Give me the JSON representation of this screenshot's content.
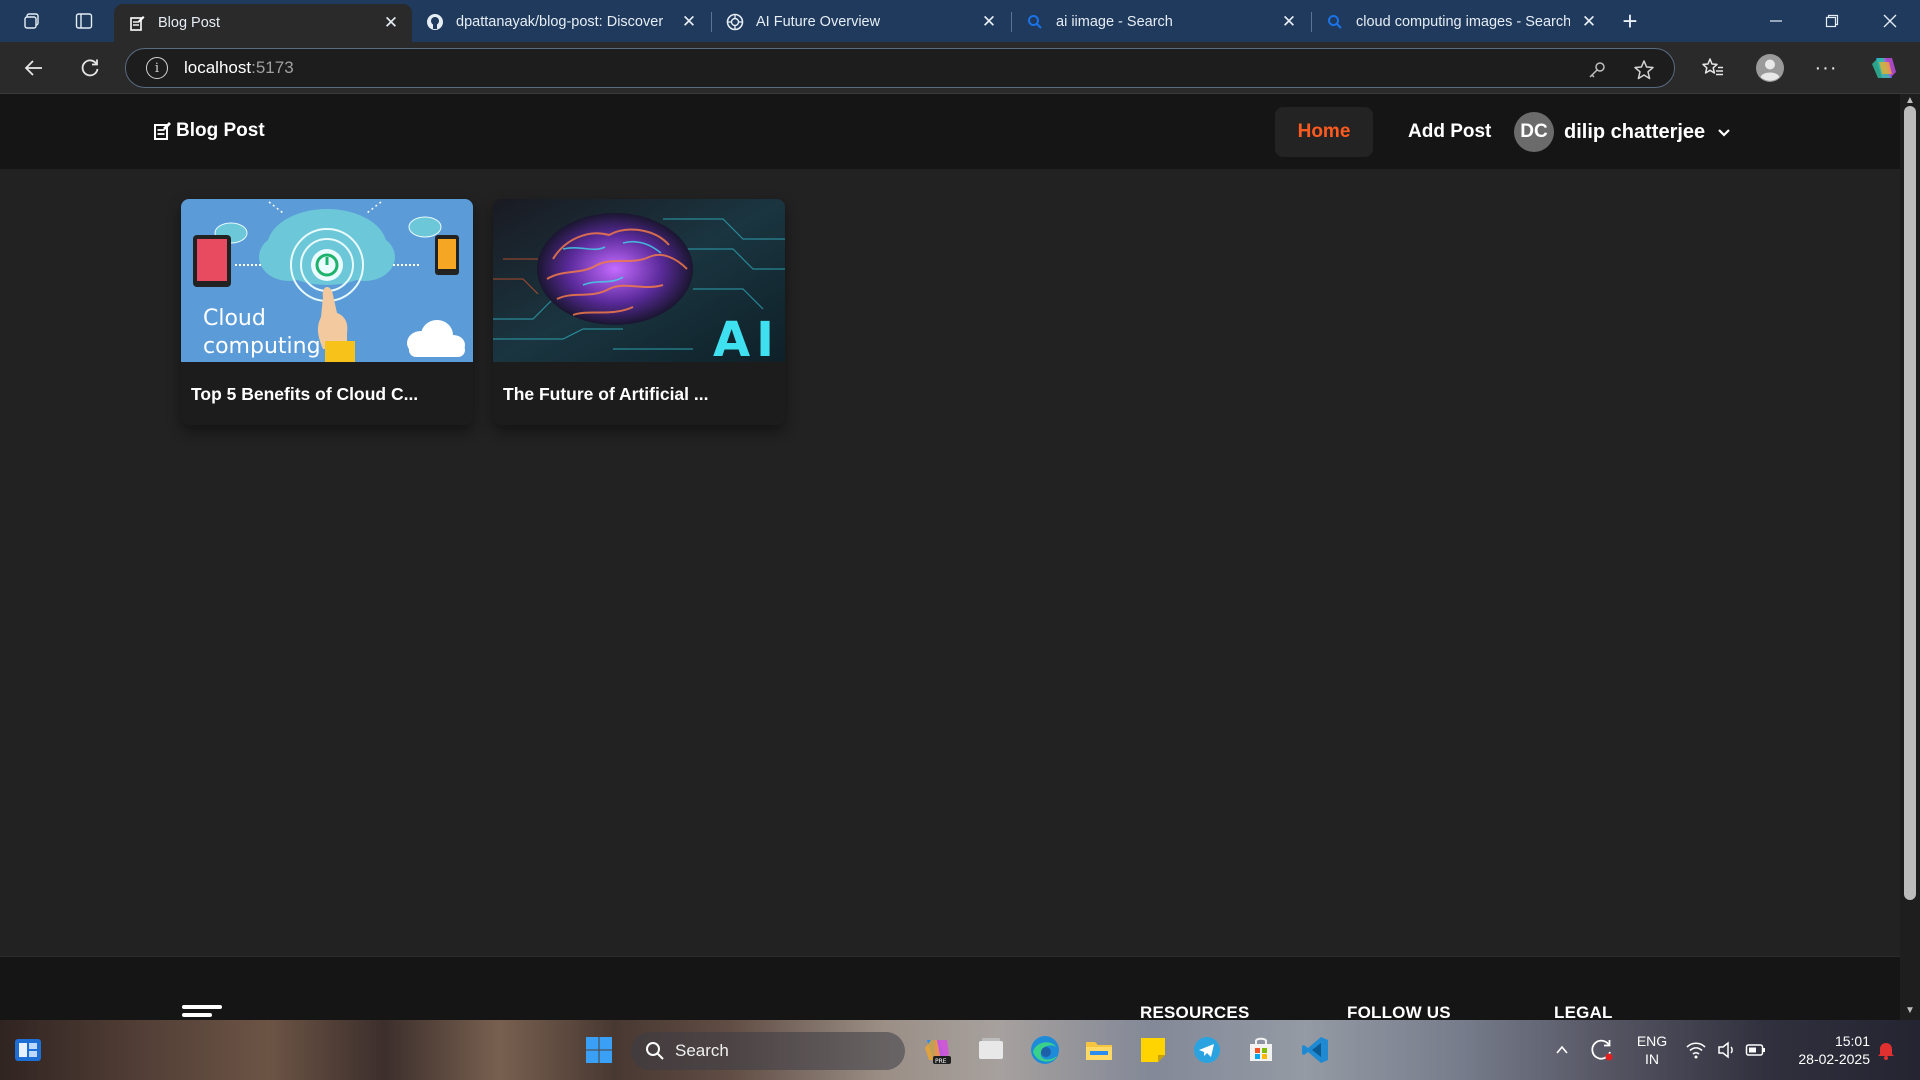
{
  "browser": {
    "tabs": [
      {
        "title": "Blog Post",
        "active": true,
        "favicon": "blog-post-icon"
      },
      {
        "title": "dpattanayak/blog-post: Discover",
        "active": false,
        "favicon": "github-icon"
      },
      {
        "title": "AI Future Overview",
        "active": false,
        "favicon": "chatgpt-icon"
      },
      {
        "title": "ai iimage - Search",
        "active": false,
        "favicon": "search-icon"
      },
      {
        "title": "cloud computing images - Search",
        "active": false,
        "favicon": "search-icon"
      }
    ],
    "address": {
      "host": "localhost",
      "port": ":5173"
    }
  },
  "app": {
    "brand": "Blog Post",
    "nav": {
      "home": "Home",
      "add_post": "Add Post"
    },
    "user": {
      "initials": "DC",
      "name": "dilip chatterjee"
    },
    "posts": [
      {
        "title": "Top 5 Benefits of Cloud C...",
        "image_text": [
          "Cloud",
          "computing"
        ]
      },
      {
        "title": "The Future of Artificial ...",
        "image_text": [
          "AI"
        ]
      }
    ],
    "footer": {
      "headings": [
        "RESOURCES",
        "FOLLOW US",
        "LEGAL"
      ]
    }
  },
  "taskbar": {
    "search_label": "Search",
    "language": [
      "ENG",
      "IN"
    ],
    "time": "15:01",
    "date": "28-02-2025"
  },
  "colors": {
    "accent": "#ff5a1f",
    "page_bg": "#222222",
    "header_bg": "#151515",
    "tabstrip_bg": "#1f3a5c"
  }
}
